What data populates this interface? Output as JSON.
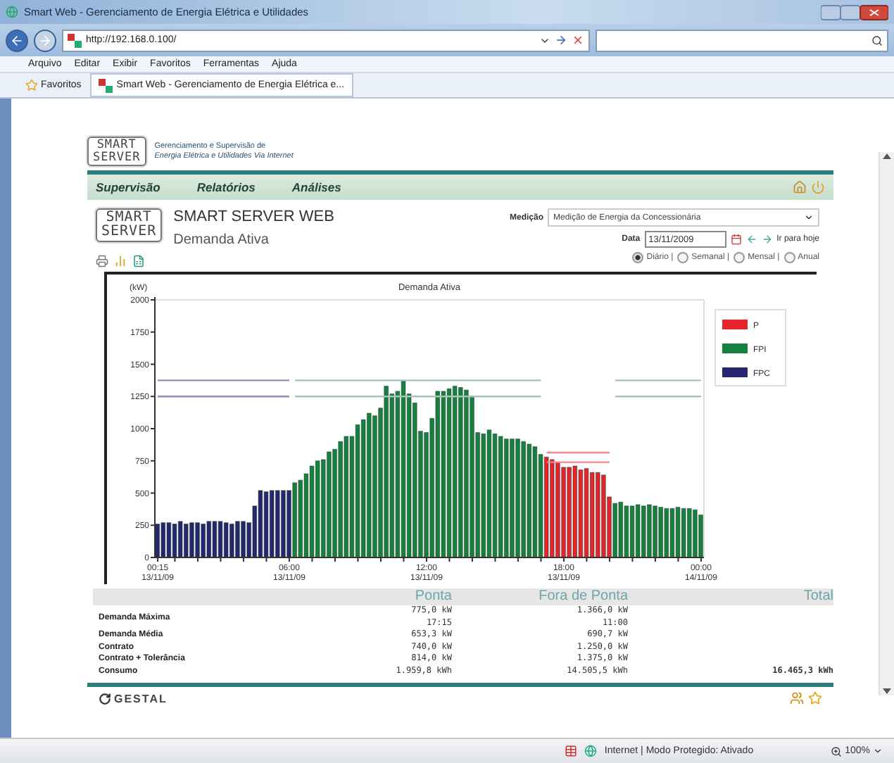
{
  "window": {
    "title": "Smart Web - Gerenciamento de Energia Elétrica e Utilidades"
  },
  "address_bar": {
    "url": "http://192.168.0.100/"
  },
  "menu": [
    "Arquivo",
    "Editar",
    "Exibir",
    "Favoritos",
    "Ferramentas",
    "Ajuda"
  ],
  "favorites_bar": {
    "label": "Favoritos",
    "tab": "Smart Web - Gerenciamento de Energia Elétrica e..."
  },
  "page": {
    "logo": [
      "SMART",
      "SERVER"
    ],
    "tagline": [
      "Gerenciamento e Supervisão de",
      "Energia Elétrica e Utilidades Via Internet"
    ],
    "nav": [
      "Supervisão",
      "Relatórios",
      "Análises"
    ],
    "header": {
      "logo": [
        "SMART",
        "SERVER"
      ],
      "title": "SMART SERVER WEB",
      "subtitle": "Demanda Ativa"
    },
    "medicao": {
      "label": "Medição",
      "value": "Medição de Energia da Concessionária"
    },
    "date": {
      "label": "Data",
      "value": "13/11/2009",
      "today_link": "Ir para hoje"
    },
    "periods": [
      {
        "label": "Diário |",
        "selected": true
      },
      {
        "label": "Semanal |",
        "selected": false
      },
      {
        "label": "Mensal |",
        "selected": false
      },
      {
        "label": "Anual",
        "selected": false
      }
    ],
    "chart_data": {
      "type": "bar",
      "title": "Demanda Ativa",
      "ylabel": "(kW)",
      "legend": "right",
      "ylim": [
        0,
        2000
      ],
      "yticks": [
        0,
        250,
        500,
        750,
        1000,
        1250,
        1500,
        1750,
        2000
      ],
      "categories": [
        "00:15 13/11/09",
        null,
        null,
        null,
        null,
        null,
        null,
        null,
        null,
        null,
        null,
        null,
        null,
        null,
        null,
        null,
        null,
        null,
        null,
        null,
        null,
        null,
        null,
        "06:00 13/11/09",
        null,
        null,
        null,
        null,
        null,
        null,
        null,
        null,
        null,
        null,
        null,
        null,
        null,
        null,
        null,
        null,
        null,
        null,
        null,
        null,
        null,
        null,
        null,
        "12:00 13/11/09",
        null,
        null,
        null,
        null,
        null,
        null,
        null,
        null,
        null,
        null,
        null,
        null,
        null,
        null,
        null,
        null,
        null,
        null,
        null,
        null,
        null,
        null,
        null,
        "18:00 13/11/09",
        null,
        null,
        null,
        null,
        null,
        null,
        null,
        null,
        null,
        null,
        null,
        null,
        null,
        null,
        null,
        null,
        null,
        null,
        null,
        null,
        null,
        null,
        null,
        "00:00 14/11/09"
      ],
      "series": [
        {
          "name": "P",
          "color": "#e5242b",
          "values": [
            null,
            null,
            null,
            null,
            null,
            null,
            null,
            null,
            null,
            null,
            null,
            null,
            null,
            null,
            null,
            null,
            null,
            null,
            null,
            null,
            null,
            null,
            null,
            null,
            null,
            null,
            null,
            null,
            null,
            null,
            null,
            null,
            null,
            null,
            null,
            null,
            null,
            null,
            null,
            null,
            null,
            null,
            null,
            null,
            null,
            null,
            null,
            null,
            null,
            null,
            null,
            null,
            null,
            null,
            null,
            null,
            null,
            null,
            null,
            null,
            null,
            null,
            null,
            null,
            null,
            null,
            null,
            null,
            780,
            760,
            740,
            700,
            700,
            710,
            680,
            690,
            660,
            660,
            640,
            470,
            null,
            null,
            null,
            null,
            null,
            null,
            null,
            null,
            null,
            null,
            null,
            null,
            null,
            null,
            null,
            null
          ]
        },
        {
          "name": "FPI",
          "color": "#17803f",
          "values": [
            null,
            null,
            null,
            null,
            null,
            null,
            null,
            null,
            null,
            null,
            null,
            null,
            null,
            null,
            null,
            null,
            null,
            null,
            null,
            null,
            null,
            null,
            null,
            null,
            580,
            600,
            650,
            710,
            750,
            760,
            820,
            840,
            900,
            940,
            940,
            1030,
            1070,
            1120,
            1100,
            1160,
            1330,
            1270,
            1290,
            1370,
            1270,
            1200,
            980,
            970,
            1080,
            1290,
            1290,
            1310,
            1330,
            1320,
            1300,
            1250,
            970,
            960,
            990,
            960,
            940,
            920,
            920,
            920,
            900,
            880,
            860,
            800,
            null,
            null,
            null,
            null,
            null,
            null,
            null,
            null,
            null,
            null,
            null,
            null,
            420,
            430,
            400,
            400,
            410,
            400,
            410,
            400,
            390,
            380,
            380,
            390,
            380,
            380,
            370,
            330
          ]
        },
        {
          "name": "FPC",
          "color": "#25286e",
          "values": [
            260,
            270,
            270,
            260,
            280,
            260,
            270,
            270,
            260,
            280,
            280,
            280,
            270,
            260,
            280,
            280,
            270,
            400,
            520,
            510,
            520,
            520,
            520,
            520,
            null,
            null,
            null,
            null,
            null,
            null,
            null,
            null,
            null,
            null,
            null,
            null,
            null,
            null,
            null,
            null,
            null,
            null,
            null,
            null,
            null,
            null,
            null,
            null,
            null,
            null,
            null,
            null,
            null,
            null,
            null,
            null,
            null,
            null,
            null,
            null,
            null,
            null,
            null,
            null,
            null,
            null,
            null,
            null,
            null,
            null,
            null,
            null,
            null,
            null,
            null,
            null,
            null,
            null,
            null,
            null,
            null,
            null,
            null,
            null,
            null,
            null,
            null,
            null,
            null,
            null,
            null,
            null,
            null,
            null,
            null,
            null
          ]
        },
        {
          "type": "line",
          "color": "#8a8fc0",
          "values": [
            1375,
            1375,
            1375,
            1375,
            1375,
            1375,
            1375,
            1375,
            1375,
            1375,
            1375,
            1375,
            1375,
            1375,
            1375,
            1375,
            1375,
            1375,
            1375,
            1375,
            1375,
            1375,
            1375,
            1375,
            null,
            null,
            null,
            null,
            null,
            null,
            null,
            null,
            null,
            null,
            null,
            null,
            null,
            null,
            null,
            null,
            null,
            null,
            null,
            null,
            null,
            null,
            null,
            null,
            null,
            null,
            null,
            null,
            null,
            null,
            null,
            null,
            null,
            null,
            null,
            null,
            null,
            null,
            null,
            null,
            null,
            null,
            null,
            null,
            null,
            null,
            null,
            null,
            null,
            null,
            null,
            null,
            null,
            null,
            null,
            null,
            null,
            null,
            null,
            null,
            null,
            null,
            null,
            null,
            null,
            null,
            null,
            null,
            null,
            null,
            null,
            null
          ]
        },
        {
          "type": "line",
          "color": "#8a8fc0",
          "values": [
            1250,
            1250,
            1250,
            1250,
            1250,
            1250,
            1250,
            1250,
            1250,
            1250,
            1250,
            1250,
            1250,
            1250,
            1250,
            1250,
            1250,
            1250,
            1250,
            1250,
            1250,
            1250,
            1250,
            1250,
            null,
            null,
            null,
            null,
            null,
            null,
            null,
            null,
            null,
            null,
            null,
            null,
            null,
            null,
            null,
            null,
            null,
            null,
            null,
            null,
            null,
            null,
            null,
            null,
            null,
            null,
            null,
            null,
            null,
            null,
            null,
            null,
            null,
            null,
            null,
            null,
            null,
            null,
            null,
            null,
            null,
            null,
            null,
            null,
            null,
            null,
            null,
            null,
            null,
            null,
            null,
            null,
            null,
            null,
            null,
            null,
            null,
            null,
            null,
            null,
            null,
            null,
            null,
            null,
            null,
            null,
            null,
            null,
            null,
            null,
            null,
            null
          ]
        },
        {
          "type": "line",
          "color": "#a9c2b6",
          "values": [
            null,
            null,
            null,
            null,
            null,
            null,
            null,
            null,
            null,
            null,
            null,
            null,
            null,
            null,
            null,
            null,
            null,
            null,
            null,
            null,
            null,
            null,
            null,
            null,
            1375,
            1375,
            1375,
            1375,
            1375,
            1375,
            1375,
            1375,
            1375,
            1375,
            1375,
            1375,
            1375,
            1375,
            1375,
            1375,
            1375,
            1375,
            1375,
            1375,
            1375,
            1375,
            1375,
            1375,
            1375,
            1375,
            1375,
            1375,
            1375,
            1375,
            1375,
            1375,
            1375,
            1375,
            1375,
            1375,
            1375,
            1375,
            1375,
            1375,
            1375,
            1375,
            1375,
            1375,
            null,
            null,
            null,
            null,
            null,
            null,
            null,
            null,
            null,
            null,
            null,
            null,
            1375,
            1375,
            1375,
            1375,
            1375,
            1375,
            1375,
            1375,
            1375,
            1375,
            1375,
            1375,
            1375,
            1375,
            1375,
            1375
          ]
        },
        {
          "type": "line",
          "color": "#a9c2b6",
          "values": [
            null,
            null,
            null,
            null,
            null,
            null,
            null,
            null,
            null,
            null,
            null,
            null,
            null,
            null,
            null,
            null,
            null,
            null,
            null,
            null,
            null,
            null,
            null,
            null,
            1250,
            1250,
            1250,
            1250,
            1250,
            1250,
            1250,
            1250,
            1250,
            1250,
            1250,
            1250,
            1250,
            1250,
            1250,
            1250,
            1250,
            1250,
            1250,
            1250,
            1250,
            1250,
            1250,
            1250,
            1250,
            1250,
            1250,
            1250,
            1250,
            1250,
            1250,
            1250,
            1250,
            1250,
            1250,
            1250,
            1250,
            1250,
            1250,
            1250,
            1250,
            1250,
            1250,
            1250,
            null,
            null,
            null,
            null,
            null,
            null,
            null,
            null,
            null,
            null,
            null,
            null,
            1250,
            1250,
            1250,
            1250,
            1250,
            1250,
            1250,
            1250,
            1250,
            1250,
            1250,
            1250,
            1250,
            1250,
            1250,
            1250
          ]
        },
        {
          "type": "line",
          "color": "#f08a8e",
          "values": [
            null,
            null,
            null,
            null,
            null,
            null,
            null,
            null,
            null,
            null,
            null,
            null,
            null,
            null,
            null,
            null,
            null,
            null,
            null,
            null,
            null,
            null,
            null,
            null,
            null,
            null,
            null,
            null,
            null,
            null,
            null,
            null,
            null,
            null,
            null,
            null,
            null,
            null,
            null,
            null,
            null,
            null,
            null,
            null,
            null,
            null,
            null,
            null,
            null,
            null,
            null,
            null,
            null,
            null,
            null,
            null,
            null,
            null,
            null,
            null,
            null,
            null,
            null,
            null,
            null,
            null,
            null,
            null,
            814,
            814,
            814,
            814,
            814,
            814,
            814,
            814,
            814,
            814,
            814,
            814,
            null,
            null,
            null,
            null,
            null,
            null,
            null,
            null,
            null,
            null,
            null,
            null,
            null,
            null,
            null,
            null
          ]
        },
        {
          "type": "line",
          "color": "#f08a8e",
          "values": [
            null,
            null,
            null,
            null,
            null,
            null,
            null,
            null,
            null,
            null,
            null,
            null,
            null,
            null,
            null,
            null,
            null,
            null,
            null,
            null,
            null,
            null,
            null,
            null,
            null,
            null,
            null,
            null,
            null,
            null,
            null,
            null,
            null,
            null,
            null,
            null,
            null,
            null,
            null,
            null,
            null,
            null,
            null,
            null,
            null,
            null,
            null,
            null,
            null,
            null,
            null,
            null,
            null,
            null,
            null,
            null,
            null,
            null,
            null,
            null,
            null,
            null,
            null,
            null,
            null,
            null,
            null,
            null,
            740,
            740,
            740,
            740,
            740,
            740,
            740,
            740,
            740,
            740,
            740,
            740,
            null,
            null,
            null,
            null,
            null,
            null,
            null,
            null,
            null,
            null,
            null,
            null,
            null,
            null,
            null,
            null
          ]
        }
      ]
    },
    "summary": {
      "columns": [
        "Ponta",
        "Fora de Ponta",
        "Total"
      ],
      "rows": [
        {
          "label": "Demanda Máxima",
          "ponta": [
            "775,0 kW",
            "17:15"
          ],
          "fora_de_ponta": [
            "1.366,0 kW",
            "11:00"
          ]
        },
        {
          "label": "Demanda Média",
          "ponta": [
            "653,3 kW"
          ],
          "fora_de_ponta": [
            "690,7 kW"
          ]
        },
        {
          "label": "Contrato",
          "ponta": [
            "740,0 kW"
          ],
          "fora_de_ponta": [
            "1.250,0 kW"
          ]
        },
        {
          "label": "Contrato + Tolerância",
          "ponta": [
            "814,0 kW"
          ],
          "fora_de_ponta": [
            "1.375,0 kW"
          ]
        },
        {
          "label": "Consumo",
          "ponta": [
            "1.959,8 kWh"
          ],
          "fora_de_ponta": [
            "14.505,5 kWh"
          ],
          "total": [
            "16.465,3 kWh"
          ]
        }
      ]
    },
    "footer": {
      "logo": "GESTAL"
    }
  },
  "status_bar": {
    "text": "Internet | Modo Protegido: Ativado",
    "zoom": "100%"
  }
}
